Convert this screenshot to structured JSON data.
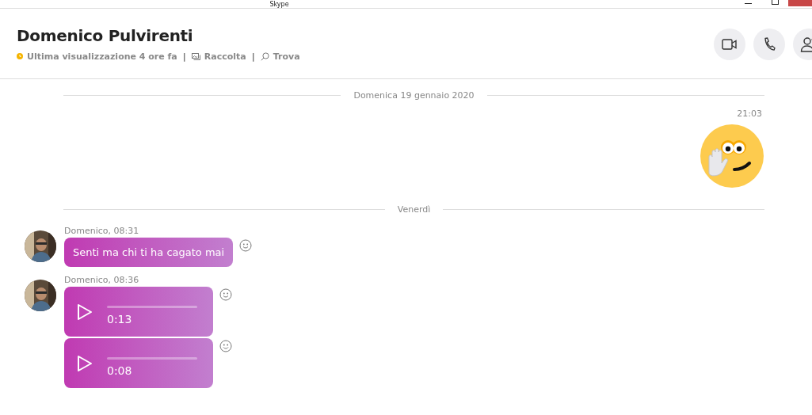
{
  "window": {
    "title": "Skype"
  },
  "header": {
    "name": "Domenico Pulvirenti",
    "status": "Ultima visualizzazione 4 ore fa",
    "links": [
      {
        "kind": "gallery",
        "separator": "|",
        "label": "Raccolta"
      },
      {
        "kind": "search",
        "separator": "|",
        "label": "Trova"
      }
    ],
    "buttons": [
      {
        "kind": "video"
      },
      {
        "kind": "call"
      },
      {
        "kind": "add-person"
      }
    ]
  },
  "conversation": [
    {
      "kind": "date",
      "text": "Domenica 19 gennaio 2020"
    },
    {
      "kind": "sent_emoticon",
      "time": "21:03"
    },
    {
      "kind": "date",
      "text": "Venerdì"
    },
    {
      "kind": "received",
      "sender": "Domenico, 08:31",
      "messages": [
        {
          "kind": "text",
          "text": "Senti ma chi ti ha cagato mai"
        }
      ]
    },
    {
      "kind": "received",
      "sender": "Domenico, 08:36",
      "messages": [
        {
          "kind": "audio",
          "duration": "0:13"
        },
        {
          "kind": "audio",
          "duration": "0:08"
        }
      ]
    }
  ]
}
